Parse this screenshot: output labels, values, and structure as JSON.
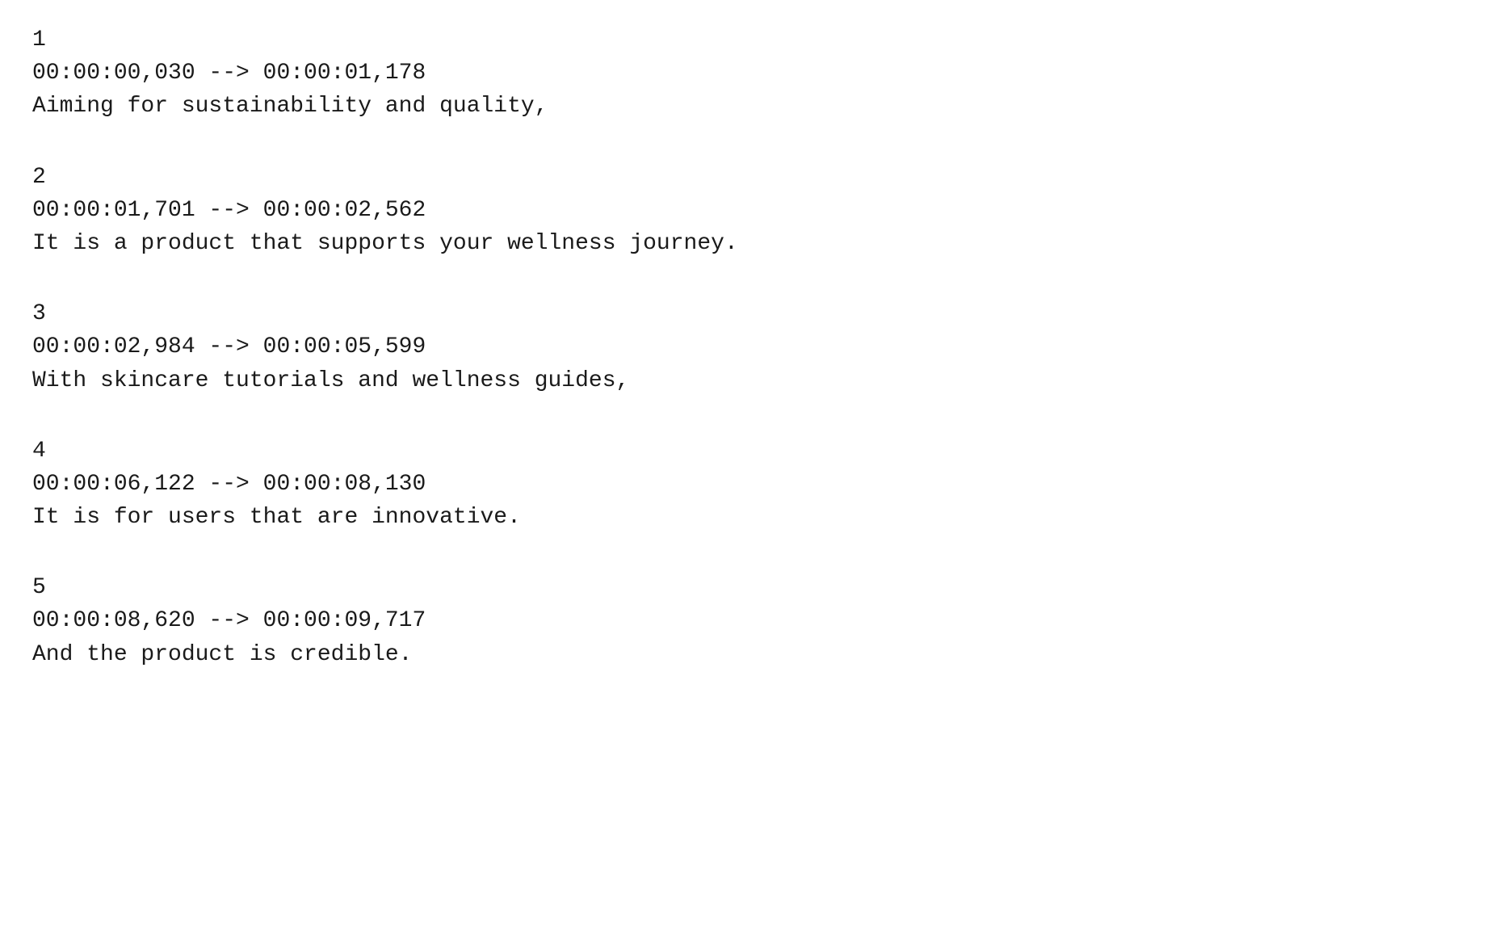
{
  "subtitles": [
    {
      "index": "1",
      "timecode": "00:00:00,030 --> 00:00:01,178",
      "text": "Aiming for sustainability and quality,"
    },
    {
      "index": "2",
      "timecode": "00:00:01,701 --> 00:00:02,562",
      "text": "It is a product that supports your wellness journey."
    },
    {
      "index": "3",
      "timecode": "00:00:02,984 --> 00:00:05,599",
      "text": "With skincare tutorials and wellness guides,"
    },
    {
      "index": "4",
      "timecode": "00:00:06,122 --> 00:00:08,130",
      "text": "It is for users that are innovative."
    },
    {
      "index": "5",
      "timecode": "00:00:08,620 --> 00:00:09,717",
      "text": "And the product is credible."
    }
  ]
}
